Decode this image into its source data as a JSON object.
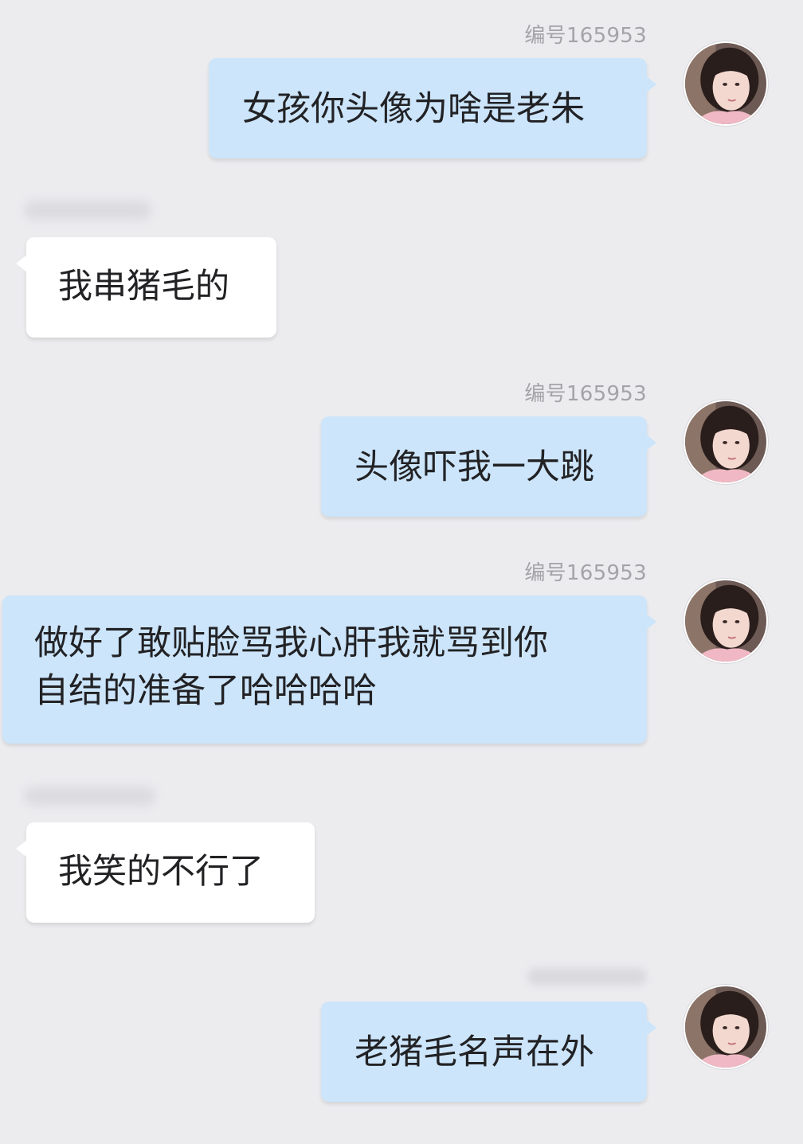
{
  "messages": [
    {
      "direction": "out",
      "sender": "编号165953",
      "text": "女孩你头像为啥是老朱"
    },
    {
      "direction": "in",
      "sender": "",
      "text": "我串猪毛的"
    },
    {
      "direction": "out",
      "sender": "编号165953",
      "text": "头像吓我一大跳"
    },
    {
      "direction": "out",
      "sender": "编号165953",
      "text_lines": [
        "做好了敢贴脸骂我心肝我就骂到你",
        "自结的准备了哈哈哈哈"
      ]
    },
    {
      "direction": "in",
      "sender": "",
      "text": "我笑的不行了"
    },
    {
      "direction": "out",
      "sender": "",
      "text": "老猪毛名声在外"
    }
  ],
  "colors": {
    "background": "#ececef",
    "outgoing_bubble": "#cce5fb",
    "incoming_bubble": "#ffffff",
    "sender_label": "#a3a3a8"
  },
  "icons": {
    "avatar": "user-avatar-icon"
  }
}
